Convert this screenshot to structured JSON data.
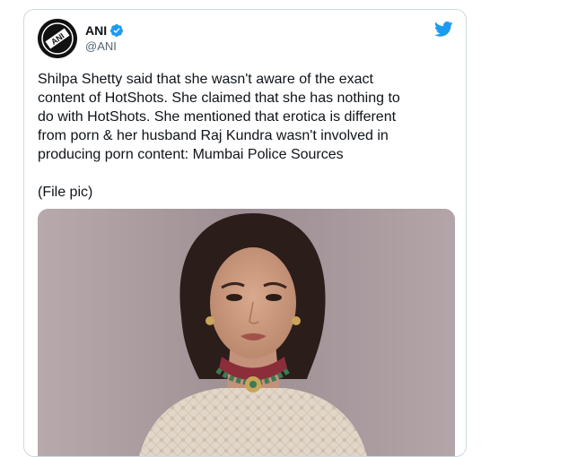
{
  "tweet": {
    "author": {
      "name": "ANI",
      "handle": "@ANI",
      "avatar_text": "ANI",
      "verified": true,
      "avatar_icon": "ani-logo-icon",
      "verified_icon": "verified-badge-icon"
    },
    "platform_icon": "twitter-bird-icon",
    "text": "Shilpa Shetty said that she wasn't aware of the exact\ncontent of HotShots. She claimed that she has nothing to\ndo with HotShots. She mentioned that erotica is different\nfrom porn & her husband Raj Kundra wasn't involved in\nproducing porn content: Mumbai Police Sources\n\n(File pic)",
    "media": {
      "type": "photo"
    }
  },
  "colors": {
    "twitter_blue": "#1d9bf0",
    "text_primary": "#0f1419",
    "text_secondary": "#536471",
    "border": "#cfd9de"
  }
}
